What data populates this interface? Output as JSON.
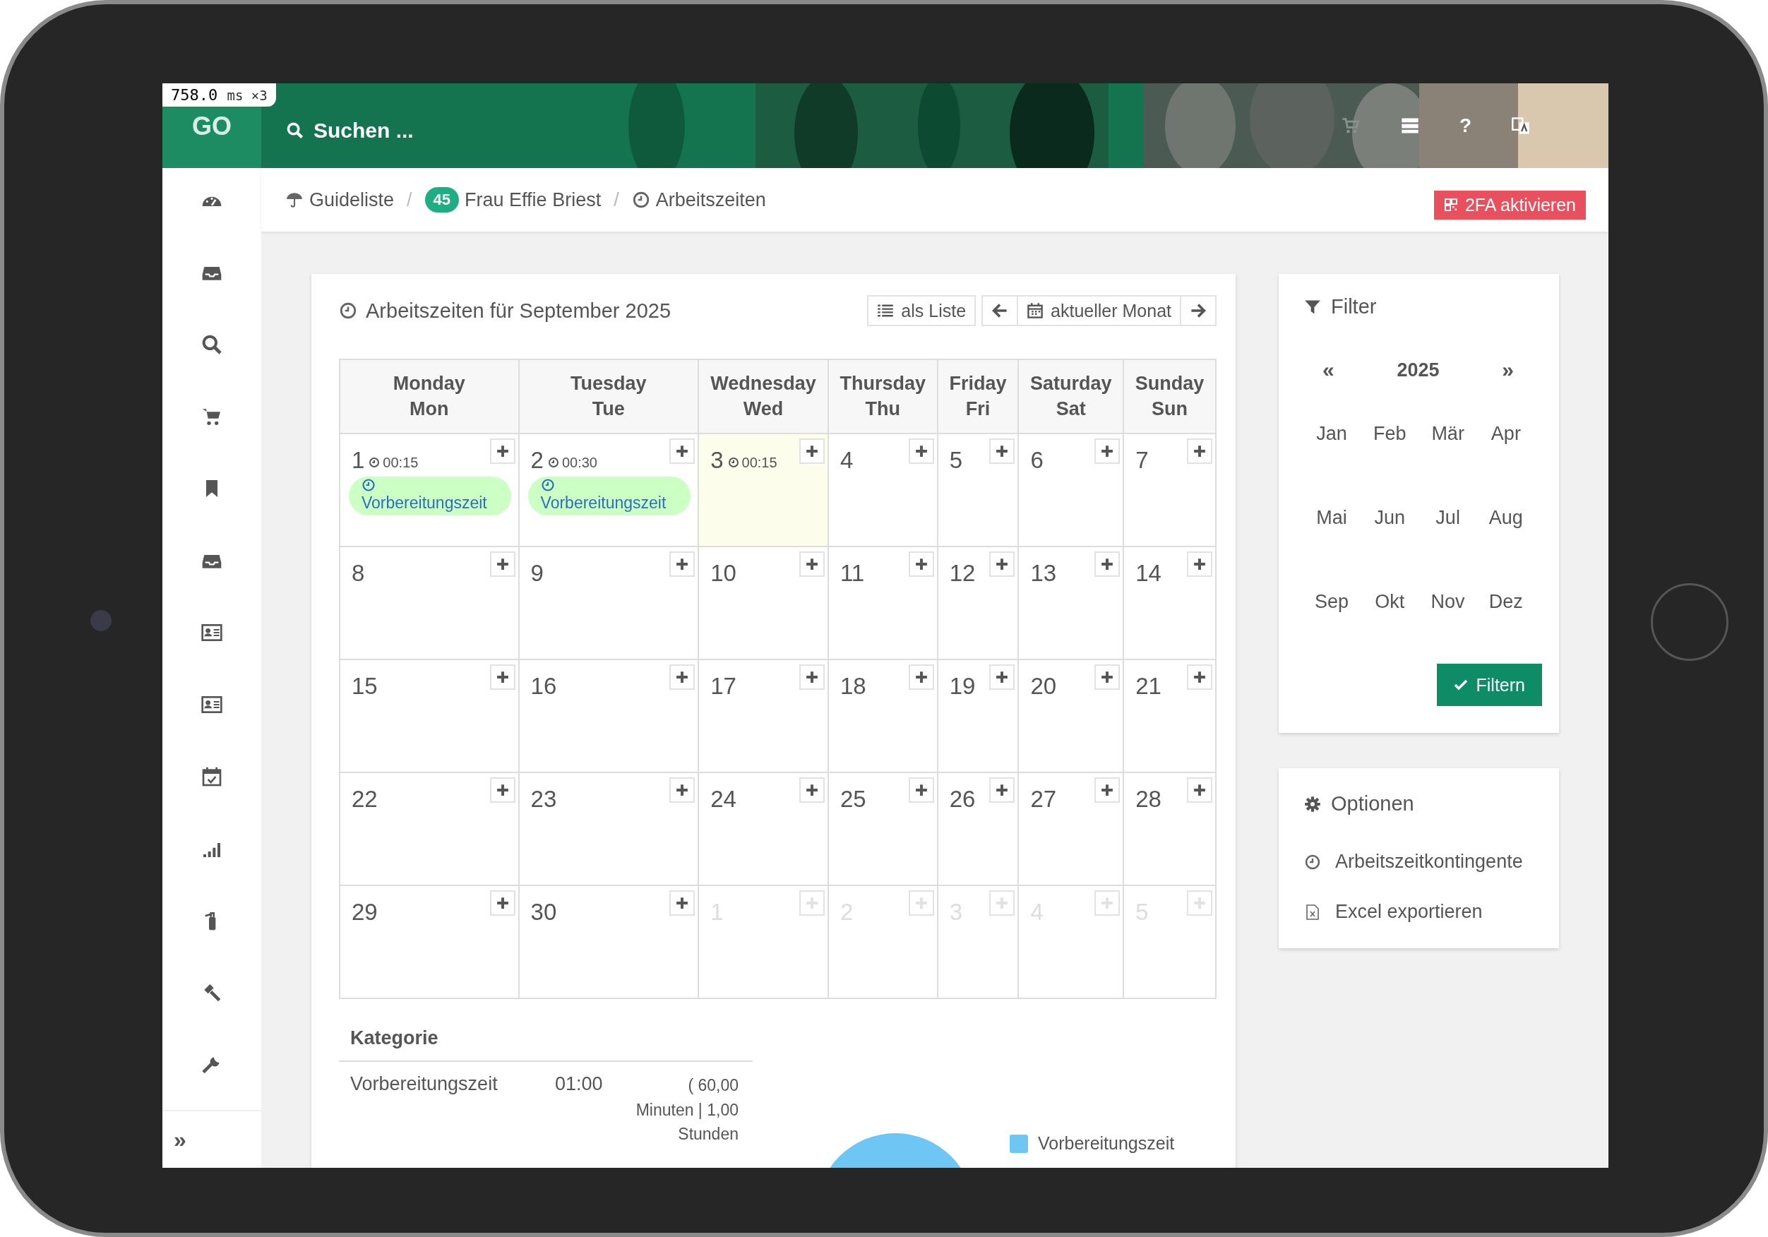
{
  "perf_overlay": {
    "value": "758.0",
    "unit": "ms",
    "count": "×3"
  },
  "header": {
    "logo": "GO",
    "search_label": "Suchen ...",
    "help": "?"
  },
  "sidebar": {
    "expand": "»"
  },
  "breadcrumb": {
    "separator": "/",
    "items": [
      {
        "kind": "link",
        "label": "Guideliste"
      },
      {
        "kind": "badge_link",
        "badge": "45",
        "label": "Frau Effie Briest"
      },
      {
        "kind": "current",
        "label": "Arbeitszeiten"
      }
    ]
  },
  "twofa_button": "2FA aktivieren",
  "calendar": {
    "title": "Arbeitszeiten für September 2025",
    "list_button": "als Liste",
    "current_month_button": "aktueller Monat",
    "columns": [
      {
        "day": "Monday",
        "short": "Mon"
      },
      {
        "day": "Tuesday",
        "short": "Tue"
      },
      {
        "day": "Wednesday",
        "short": "Wed"
      },
      {
        "day": "Thursday",
        "short": "Thu"
      },
      {
        "day": "Friday",
        "short": "Fri"
      },
      {
        "day": "Saturday",
        "short": "Sat"
      },
      {
        "day": "Sunday",
        "short": "Sun"
      }
    ],
    "weeks": [
      [
        {
          "day": "1",
          "time": "00:15",
          "today": false,
          "other_month": false,
          "entries": [
            {
              "label": "Vorbereitungszeit"
            }
          ]
        },
        {
          "day": "2",
          "time": "00:30",
          "today": false,
          "other_month": false,
          "entries": [
            {
              "label": "Vorbereitungszeit"
            }
          ]
        },
        {
          "day": "3",
          "time": "00:15",
          "today": true,
          "other_month": false
        },
        {
          "day": "4",
          "today": false,
          "other_month": false
        },
        {
          "day": "5",
          "today": false,
          "other_month": false
        },
        {
          "day": "6",
          "today": false,
          "other_month": false
        },
        {
          "day": "7",
          "today": false,
          "other_month": false
        }
      ],
      [
        {
          "day": "8",
          "today": false,
          "other_month": false
        },
        {
          "day": "9",
          "today": false,
          "other_month": false
        },
        {
          "day": "10",
          "today": false,
          "other_month": false
        },
        {
          "day": "11",
          "today": false,
          "other_month": false
        },
        {
          "day": "12",
          "today": false,
          "other_month": false
        },
        {
          "day": "13",
          "today": false,
          "other_month": false
        },
        {
          "day": "14",
          "today": false,
          "other_month": false
        }
      ],
      [
        {
          "day": "15",
          "today": false,
          "other_month": false
        },
        {
          "day": "16",
          "today": false,
          "other_month": false
        },
        {
          "day": "17",
          "today": false,
          "other_month": false
        },
        {
          "day": "18",
          "today": false,
          "other_month": false
        },
        {
          "day": "19",
          "today": false,
          "other_month": false
        },
        {
          "day": "20",
          "today": false,
          "other_month": false
        },
        {
          "day": "21",
          "today": false,
          "other_month": false
        }
      ],
      [
        {
          "day": "22",
          "today": false,
          "other_month": false
        },
        {
          "day": "23",
          "today": false,
          "other_month": false
        },
        {
          "day": "24",
          "today": false,
          "other_month": false
        },
        {
          "day": "25",
          "today": false,
          "other_month": false
        },
        {
          "day": "26",
          "today": false,
          "other_month": false
        },
        {
          "day": "27",
          "today": false,
          "other_month": false
        },
        {
          "day": "28",
          "today": false,
          "other_month": false
        }
      ],
      [
        {
          "day": "29",
          "today": false,
          "other_month": false
        },
        {
          "day": "30",
          "today": false,
          "other_month": false
        },
        {
          "day": "1",
          "today": false,
          "other_month": true
        },
        {
          "day": "2",
          "today": false,
          "other_month": true
        },
        {
          "day": "3",
          "today": false,
          "other_month": true
        },
        {
          "day": "4",
          "today": false,
          "other_month": true
        },
        {
          "day": "5",
          "today": false,
          "other_month": true
        }
      ]
    ]
  },
  "summary": {
    "heading": "Kategorie",
    "rows": [
      {
        "category": "Vorbereitungszeit",
        "time": "01:00",
        "detail": "( 60,00 Minuten | 1,00 Stunden"
      }
    ],
    "legend": [
      {
        "label": "Vorbereitungszeit",
        "color": "#6ec6f5"
      }
    ]
  },
  "filter": {
    "title": "Filter",
    "prev": "«",
    "year": "2025",
    "next": "»",
    "months": [
      {
        "label": "Jan",
        "selected": false
      },
      {
        "label": "Feb",
        "selected": false
      },
      {
        "label": "Mär",
        "selected": false
      },
      {
        "label": "Apr",
        "selected": false
      },
      {
        "label": "Mai",
        "selected": false
      },
      {
        "label": "Jun",
        "selected": false
      },
      {
        "label": "Jul",
        "selected": false
      },
      {
        "label": "Aug",
        "selected": false
      },
      {
        "label": "Sep",
        "selected": false
      },
      {
        "label": "Okt",
        "selected": false
      },
      {
        "label": "Nov",
        "selected": false
      },
      {
        "label": "Dez",
        "selected": false
      }
    ],
    "button": "Filtern"
  },
  "options": {
    "title": "Optionen",
    "items": [
      {
        "kind": "clock",
        "label": "Arbeitszeitkontingente"
      },
      {
        "kind": "excel",
        "label": "Excel exportieren"
      }
    ]
  }
}
